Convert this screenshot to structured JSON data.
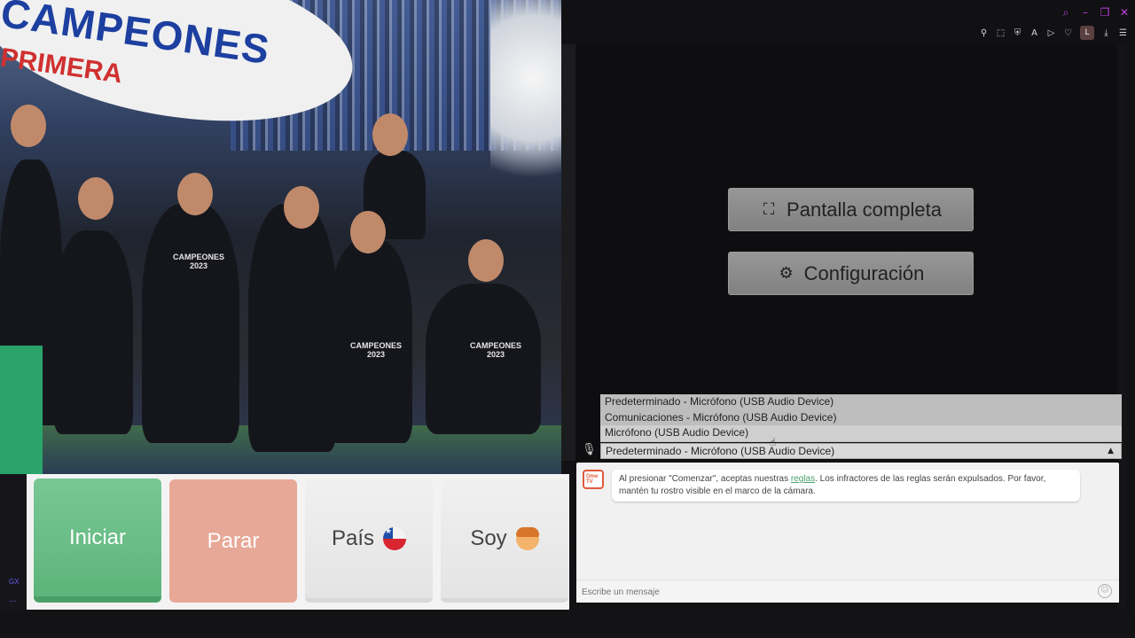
{
  "browser": {
    "ext_avatar_letter": "L"
  },
  "photo": {
    "banner_line1": "CAMPEONES",
    "banner_line2": "PRIMERA",
    "shirt_text": [
      "CAMPEONES",
      "2023"
    ]
  },
  "controls": {
    "fullscreen_label": "Pantalla completa",
    "settings_label": "Configuración"
  },
  "microphone": {
    "options": [
      "Predeterminado - Micrófono (USB Audio Device)",
      "Comunicaciones - Micrófono (USB Audio Device)",
      "Micrófono (USB Audio Device)"
    ],
    "selected": "Predeterminado - Micrófono (USB Audio Device)"
  },
  "actions": {
    "start_label": "Iniciar",
    "stop_label": "Parar",
    "country_label": "País",
    "gender_label": "Soy"
  },
  "chat": {
    "logo_text": "Ome TV",
    "rules_prefix": "Al presionar \"Comenzar\", aceptas nuestras ",
    "rules_link": "reglas",
    "rules_suffix": ". Los infractores de las reglas serán expulsados. Por favor, mantén tu rostro visible en el marco de la cámara.",
    "input_placeholder": "Escribe un mensaje"
  },
  "sidebar": {
    "gx_label": "GX",
    "more_label": "..."
  },
  "colors": {
    "start": "#5db57b",
    "stop": "#e8a897",
    "accent_link": "#4a9f68",
    "window_controls": "#c040e0"
  }
}
